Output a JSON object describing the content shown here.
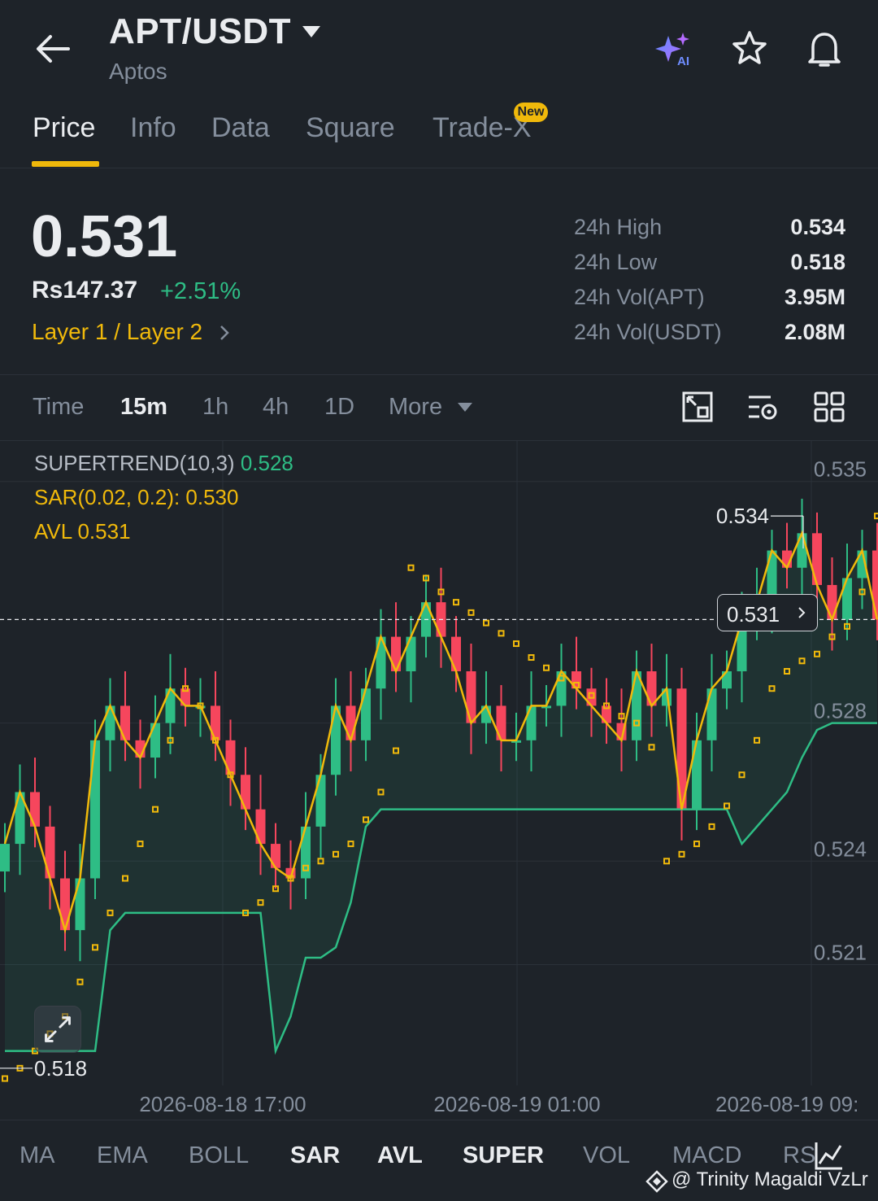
{
  "header": {
    "pair": "APT/USDT",
    "name": "Aptos"
  },
  "tabs": [
    {
      "label": "Price",
      "active": true
    },
    {
      "label": "Info"
    },
    {
      "label": "Data"
    },
    {
      "label": "Square"
    },
    {
      "label": "Trade-X",
      "badge": "New"
    }
  ],
  "ticker": {
    "price": "0.531",
    "fiat": "Rs147.37",
    "change": "+2.51%",
    "category": "Layer 1 / Layer 2",
    "stats": [
      {
        "label": "24h High",
        "value": "0.534"
      },
      {
        "label": "24h Low",
        "value": "0.518"
      },
      {
        "label": "24h Vol(APT)",
        "value": "3.95M"
      },
      {
        "label": "24h Vol(USDT)",
        "value": "2.08M"
      }
    ]
  },
  "timeframes": [
    {
      "label": "Time"
    },
    {
      "label": "15m",
      "active": true
    },
    {
      "label": "1h"
    },
    {
      "label": "4h"
    },
    {
      "label": "1D"
    },
    {
      "label": "More"
    }
  ],
  "indicators": {
    "supertrend_label": "SUPERTREND(10,3)",
    "supertrend_value": "0.528",
    "sar": "SAR(0.02, 0.2): 0.530",
    "avl": "AVL 0.531"
  },
  "chart_data": {
    "type": "candlestick",
    "y_ticks": [
      0.535,
      0.528,
      0.524,
      0.521
    ],
    "y_tick_labels": [
      "0.535",
      "0.528",
      "0.524",
      "0.521"
    ],
    "x_tick_labels": [
      "2026-08-18 17:00",
      "2026-08-19 01:00",
      "2026-08-19 09:"
    ],
    "ylim": [
      0.5175,
      0.5357
    ],
    "current_price": "0.531",
    "high_marker": "0.534",
    "low_marker": "0.518",
    "close": [
      0.5245,
      0.526,
      0.525,
      0.5235,
      0.522,
      0.5235,
      0.5275,
      0.5285,
      0.5275,
      0.527,
      0.528,
      0.529,
      0.5285,
      0.5285,
      0.5275,
      0.5265,
      0.5255,
      0.5245,
      0.5238,
      0.5235,
      0.525,
      0.5265,
      0.5285,
      0.5275,
      0.529,
      0.5305,
      0.5295,
      0.5305,
      0.5315,
      0.5305,
      0.5295,
      0.528,
      0.5285,
      0.5275,
      0.5275,
      0.5285,
      0.5285,
      0.5295,
      0.529,
      0.5285,
      0.528,
      0.5275,
      0.5295,
      0.5285,
      0.529,
      0.5255,
      0.5275,
      0.529,
      0.5295,
      0.531,
      0.5315,
      0.533,
      0.5325,
      0.5335,
      0.532,
      0.531,
      0.5322,
      0.533,
      0.531
    ],
    "supertrend": [
      0.5185,
      0.5185,
      0.5185,
      0.5185,
      0.5185,
      0.5185,
      0.5185,
      0.522,
      0.5225,
      0.5225,
      0.5225,
      0.5225,
      0.5225,
      0.5225,
      0.5225,
      0.5225,
      0.5225,
      0.5225,
      0.5185,
      0.5195,
      0.5212,
      0.5212,
      0.5215,
      0.5228,
      0.525,
      0.5255,
      0.5255,
      0.5255,
      0.5255,
      0.5255,
      0.5255,
      0.5255,
      0.5255,
      0.5255,
      0.5255,
      0.5255,
      0.5255,
      0.5255,
      0.5255,
      0.5255,
      0.5255,
      0.5255,
      0.5255,
      0.5255,
      0.5255,
      0.5255,
      0.5255,
      0.5255,
      0.5255,
      0.5245,
      0.525,
      0.5255,
      0.526,
      0.527,
      0.5278,
      0.528,
      0.528,
      0.528,
      0.528
    ],
    "sar": [
      0.5177,
      0.518,
      0.5185,
      0.519,
      0.5195,
      0.5205,
      0.5215,
      0.5225,
      0.5235,
      0.5245,
      0.5255,
      0.5275,
      0.529,
      0.5285,
      0.5275,
      0.5265,
      0.5225,
      0.5228,
      0.5232,
      0.5235,
      0.5238,
      0.524,
      0.5242,
      0.5245,
      0.5252,
      0.526,
      0.5272,
      0.5325,
      0.5322,
      0.5318,
      0.5315,
      0.5312,
      0.5309,
      0.5306,
      0.5303,
      0.5299,
      0.5296,
      0.5293,
      0.5291,
      0.5288,
      0.5285,
      0.5282,
      0.528,
      0.5273,
      0.524,
      0.5242,
      0.5245,
      0.525,
      0.5256,
      0.5265,
      0.5275,
      0.529,
      0.5295,
      0.5298,
      0.53,
      0.5305,
      0.5308,
      0.5318,
      0.534
    ]
  },
  "bottom_indicators": [
    {
      "label": "MA"
    },
    {
      "label": "EMA"
    },
    {
      "label": "BOLL"
    },
    {
      "label": "SAR",
      "on": true
    },
    {
      "label": "AVL",
      "on": true
    },
    {
      "label": "SUPER",
      "on": true
    },
    {
      "label": "VOL"
    },
    {
      "label": "MACD"
    },
    {
      "label": "RS"
    }
  ],
  "watermark": "@ Trinity Magaldi VzLr",
  "colors": {
    "up": "#2ebd85",
    "down": "#f6465d",
    "accent": "#f0b90b",
    "sar": "#f0b90b"
  }
}
